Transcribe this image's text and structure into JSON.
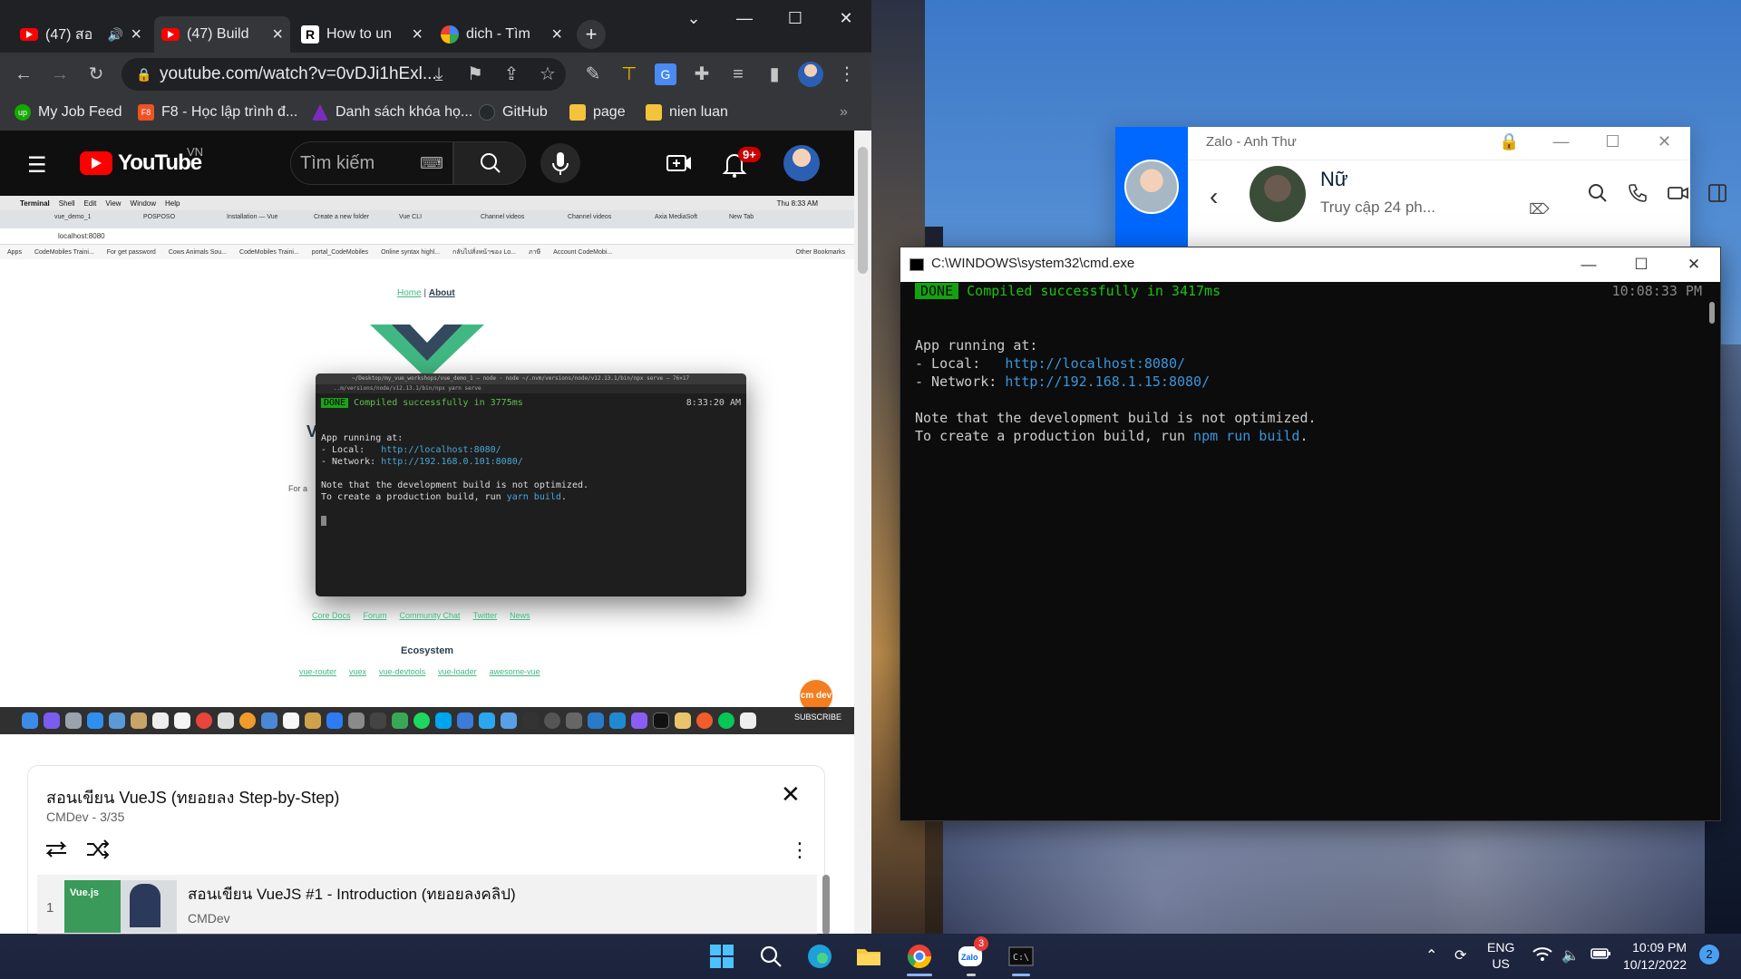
{
  "chrome": {
    "tabs": [
      {
        "title": "(47) สอ",
        "icon": "youtube"
      },
      {
        "title": "(47) Build",
        "icon": "youtube"
      },
      {
        "title": "How to un",
        "icon": "r-logo"
      },
      {
        "title": "dich - Tìm",
        "icon": "google"
      }
    ],
    "new_tab_glyph": "+",
    "url": "youtube.com/watch?v=0vDJi1hExl...",
    "bookmarks": [
      {
        "label": "My Job Feed",
        "color": "#14a800"
      },
      {
        "label": "F8 - Học lập trình đ...",
        "color": "#f05123"
      },
      {
        "label": "Danh sách khóa họ...",
        "color": "#7b2cbf"
      },
      {
        "label": "GitHub",
        "color": "#24292e"
      },
      {
        "label": "page",
        "color": "#f3c33b"
      },
      {
        "label": "nien luan",
        "color": "#f3c33b"
      }
    ],
    "more_glyph": "»"
  },
  "youtube": {
    "logo_text": "YouTube",
    "region": "VN",
    "search_placeholder": "Tìm kiếm",
    "notif_count": "9+"
  },
  "video": {
    "mac_menu": [
      "Terminal",
      "Shell",
      "Edit",
      "View",
      "Window",
      "Help"
    ],
    "mac_clock": "Thu 8:33 AM",
    "mac_tabs": [
      "vue_demo_1",
      "POSPOSO",
      "Installation — Vue",
      "Create a new folder",
      "Vue CLI",
      "Channel videos",
      "Channel videos",
      "Axia MediaSoft",
      "New Tab"
    ],
    "mac_url": "localhost:8080",
    "mac_bookmarks": [
      "Apps",
      "CodeMobiles Traini...",
      "For get password",
      "Cows Animals Sou...",
      "CodeMobiles Traini...",
      "portal_CodeMobiles",
      "Online syntax highl...",
      "กลับไปสั่งหน้าของ Lo...",
      "ภาษี",
      "Account CodeMobi...",
      "Other Bookmarks"
    ],
    "vue_nav_home": "Home",
    "vue_nav_sep": " | ",
    "vue_nav_about": "About",
    "term_title": "~/Desktop/my_vue_workshops/vue_demo_1 — node · node ~/.nvm/versions/node/v12.13.1/bin/npx serve — 76×17",
    "term_tab": "..m/versions/node/v12.13.1/bin/npx yarn serve",
    "term_done": "DONE",
    "term_compiled": "Compiled successfully in 3775ms",
    "term_time": "8:33:20 AM",
    "term_running": "App running at:",
    "term_local_label": "- Local:   ",
    "term_local_url": "http://localhost:8080/",
    "term_network_label": "- Network: ",
    "term_network_url": "http://192.168.0.101:8080/",
    "term_note": "Note that the development build is not optimized.",
    "term_prod": "To create a production build, run ",
    "term_prod_cmd": "yarn build",
    "term_prod_end": ".",
    "vue_heading_partial": "V",
    "vue_fora_partial": "For a",
    "vue_links": [
      "Core Docs",
      "Forum",
      "Community Chat",
      "Twitter",
      "News"
    ],
    "eco_title": "Ecosystem",
    "eco_links": [
      "vue-router",
      "vuex",
      "vue-devtools",
      "vue-loader",
      "awesome-vue"
    ],
    "cmdev_badge": "cm dev",
    "subscribe": "SUBSCRIBE"
  },
  "playlist": {
    "title": "สอนเขียน VueJS (ทยอยลง Step-by-Step)",
    "channel_progress": "CMDev - 3/35",
    "item": {
      "index": "1",
      "title": "สอนเขียน VueJS #1 - Introduction (ทยอยลงคลิป)",
      "channel": "CMDev",
      "thumb_text": "Vue.js"
    }
  },
  "zalo": {
    "window_title": "Zalo - Anh Thư",
    "contact_name": "Nữ",
    "status": "Truy cập 24 ph..."
  },
  "cmd": {
    "title": "C:\\WINDOWS\\system32\\cmd.exe",
    "done": "DONE",
    "compiled": "Compiled successfully in 3417ms",
    "time": "10:08:33 PM",
    "running": "App running at:",
    "local_label": "- Local:   ",
    "local_url": "http://localhost:8080/",
    "network_label": "- Network: ",
    "network_url": "http://192.168.1.15:8080/",
    "note": "Note that the development build is not optimized.",
    "prod": "To create a production build, run ",
    "prod_cmd": "npm run build",
    "prod_end": "."
  },
  "taskbar": {
    "lang_top": "ENG",
    "lang_bottom": "US",
    "time": "10:09 PM",
    "date": "10/12/2022",
    "notif_count": "2",
    "zalo_badge": "3"
  }
}
